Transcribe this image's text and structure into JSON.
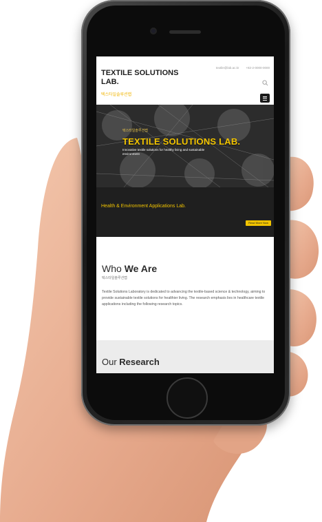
{
  "site": {
    "brand": "TEXTILE SOLUTIONS LAB.",
    "brand_sub": "텍스타일솔루션랩",
    "email": "textile@lab.ac.kr",
    "phone": "+82-2-0000-0000"
  },
  "hero": {
    "small": "텍스타일솔루션랩",
    "title": "TEXTILE SOLUTIONS LAB.",
    "desc": "Innovative textile solutions for healthy living and sustainable environment"
  },
  "band": {
    "tagline": "Health & Environment Applications Lab.",
    "read_more": "Read More Now"
  },
  "who": {
    "title_light": "Who",
    "title_bold": "We Are",
    "sub": "텍스타일솔루션랩",
    "body": "Textile Solutions Laboratory is dedicated to advancing the textile-based science & technology, aiming to provide sustainable textile solutions for healthier living. The research emphasis lies in healthcare textile applications including the following research topics."
  },
  "research": {
    "title_light": "Our",
    "title_bold": "Research"
  },
  "colors": {
    "accent": "#f2c400",
    "dark_band": "#1f1f1f",
    "phone_body": "#1a1a1a"
  }
}
